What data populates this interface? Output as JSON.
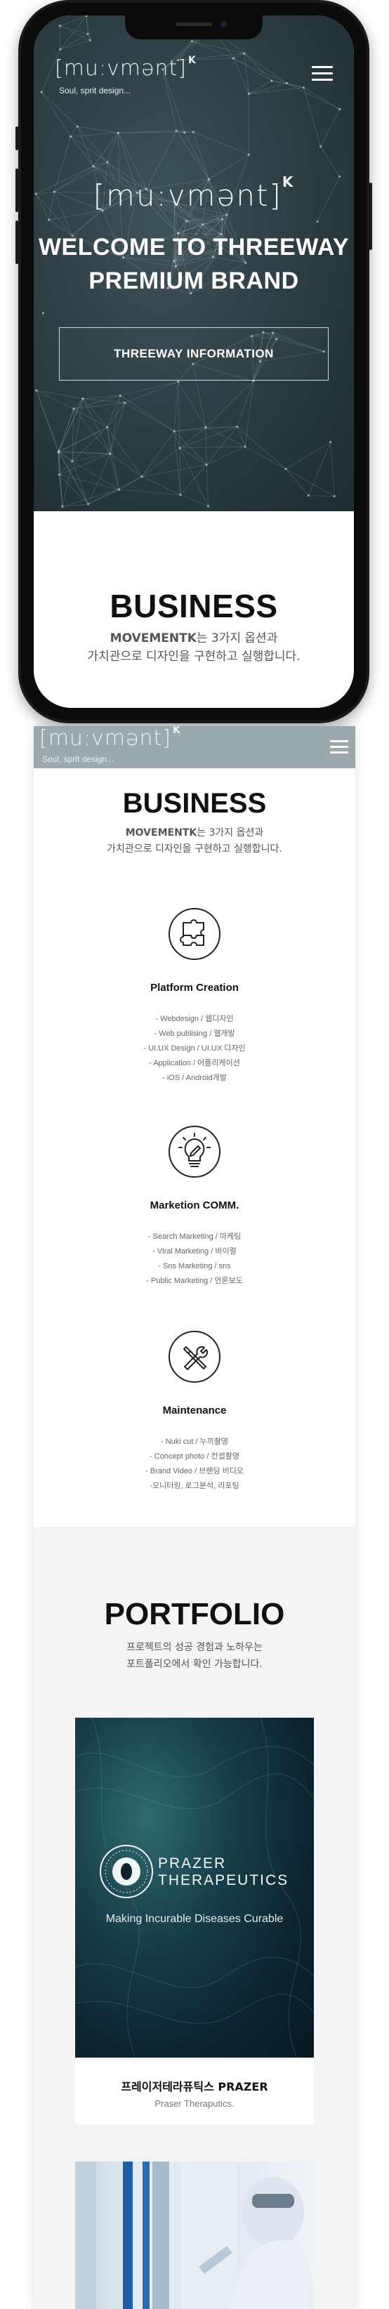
{
  "brand": {
    "logo": "[mu:vmənt]",
    "logo_sup": "K",
    "tagline": "Soul, sprit design..."
  },
  "hero": {
    "logo": "[mu:vmənt]",
    "logo_sup": "K",
    "title_line1": "WELCOME TO THREEWAY",
    "title_line2": "PREMIUM BRAND",
    "button_label": "THREEWAY INFORMATION"
  },
  "business": {
    "title": "BUSINESS",
    "desc_brand": "MOVEMENTK",
    "desc_line1_rest": "는 3가지 옵션과",
    "desc_line2": "가치관으로 디자인을 구현하고 실행합니다.",
    "services": [
      {
        "icon": "puzzle-icon",
        "title": "Platform Creation",
        "items": [
          "- Webdesign / 웹디자인",
          "- Web publising / 웹개발",
          "- UI.UX Design / UI.UX 디자인",
          "- Application / 어플리케이션",
          "- iOS / Android개발"
        ]
      },
      {
        "icon": "lightbulb-icon",
        "title": "Marketion COMM.",
        "items": [
          "- Search Marketing / 마케팅",
          "- Viral Marketing / 바이럴",
          "- Sns Marketing / sns",
          "- Public Marketing / 언론보도"
        ]
      },
      {
        "icon": "tools-icon",
        "title": "Maintenance",
        "items": [
          "- Nuki cut / 누끼촬영",
          "- Concept photo / 컨셉촬영",
          "- Brand Video / 브랜딩 비디오",
          "-모니터링, 로그분석, 리포팅"
        ]
      }
    ]
  },
  "portfolio": {
    "title": "PORTFOLIO",
    "desc_line1": "프로젝트의 성공 경험과 노하우는",
    "desc_line2": "포트폴리오에서 확인 가능합니다.",
    "items": [
      {
        "brand_line1": "PRAZER",
        "brand_line2": "THERAPEUTICS",
        "tagline": "Making Incurable Diseases Curable",
        "title": "프레이저테라퓨틱스 PRAZER",
        "subtitle": "Praser Theraputics."
      },
      {
        "image": "laboratory-photo"
      }
    ]
  },
  "colors": {
    "header_bg": "#99a9ac",
    "hero_bg": "#2b3c41",
    "section_gray": "#f4f4f4",
    "text_dark": "#111111"
  }
}
